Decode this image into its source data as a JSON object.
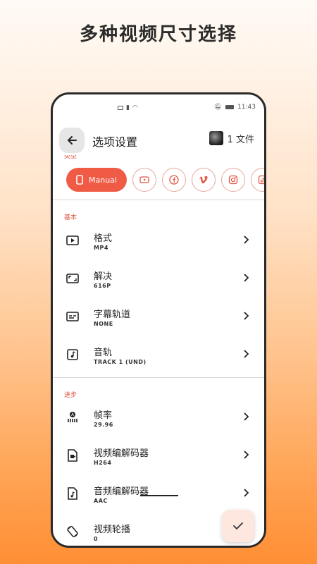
{
  "headline": "多种视频尺寸选择",
  "status_bar": {
    "time": "11:43"
  },
  "app_bar": {
    "title": "选项设置",
    "file_count": "1 文件"
  },
  "type_section_label": "类型",
  "chips": {
    "active_label": "Manual",
    "icons": [
      "youtube-icon",
      "facebook-icon",
      "vimeo-icon",
      "instagram-icon",
      "tiktok-icon"
    ]
  },
  "basic_section_label": "基本",
  "basic_items": [
    {
      "title": "格式",
      "value": "MP4",
      "icon": "play-box-icon"
    },
    {
      "title": "解决",
      "value": "616P",
      "icon": "resolution-icon"
    },
    {
      "title": "字幕轨道",
      "value": "NONE",
      "icon": "subtitles-icon"
    },
    {
      "title": "音轨",
      "value": "TRACK 1 (UND)",
      "icon": "music-note-icon"
    }
  ],
  "advanced_section_label": "进步",
  "advanced_items": [
    {
      "title": "帧率",
      "value": "29.96",
      "icon": "frame-rate-icon"
    },
    {
      "title": "视频编解码器",
      "value": "H264",
      "icon": "video-file-icon"
    },
    {
      "title": "音频编解码器",
      "value": "AAC",
      "icon": "audio-file-icon"
    },
    {
      "title": "视频轮播",
      "value": "0",
      "icon": "rotate-icon"
    }
  ],
  "colors": {
    "accent": "#ef5b45",
    "section_label": "#e25540"
  }
}
